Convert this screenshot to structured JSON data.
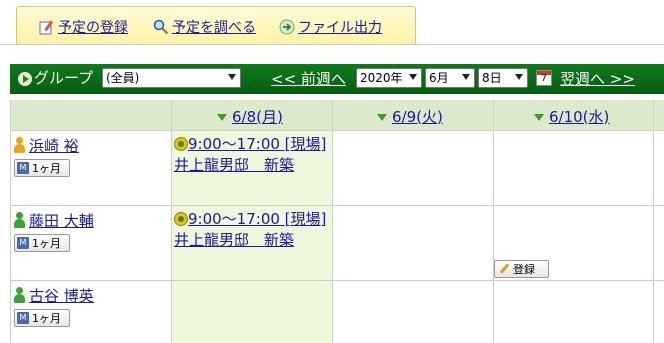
{
  "tabs": {
    "register": "予定の登録",
    "search": "予定を調べる",
    "file_output": "ファイル出力"
  },
  "toolbar": {
    "group_label": "グループ",
    "group_select": "(全員)",
    "prev_week": "<< 前週へ",
    "year": "2020年",
    "month": "6月",
    "day": "8日",
    "next_week": "翌週へ >>"
  },
  "days": [
    "6/8(月)",
    "6/9(火)",
    "6/10(水)"
  ],
  "people": [
    {
      "name": "浜崎 裕",
      "month_button": "1ヶ月",
      "icon_color": "#e8a323"
    },
    {
      "name": "藤田 大輔",
      "month_button": "1ヶ月",
      "icon_color": "#3aa23a"
    },
    {
      "name": "古谷 博英",
      "month_button": "1ヶ月",
      "icon_color": "#3aa23a"
    }
  ],
  "events": [
    {
      "text": "9:00～17:00 [現場]井上龍男邸　新築"
    },
    {
      "text": "9:00～17:00 [現場]井上龍男邸　新築"
    }
  ],
  "register_button": "登録",
  "colors": {
    "toolbar_green": "#0a6e16",
    "header_green": "#dbeacb",
    "today_column": "#eff7dc",
    "link_blue": "#1a1a9c"
  }
}
